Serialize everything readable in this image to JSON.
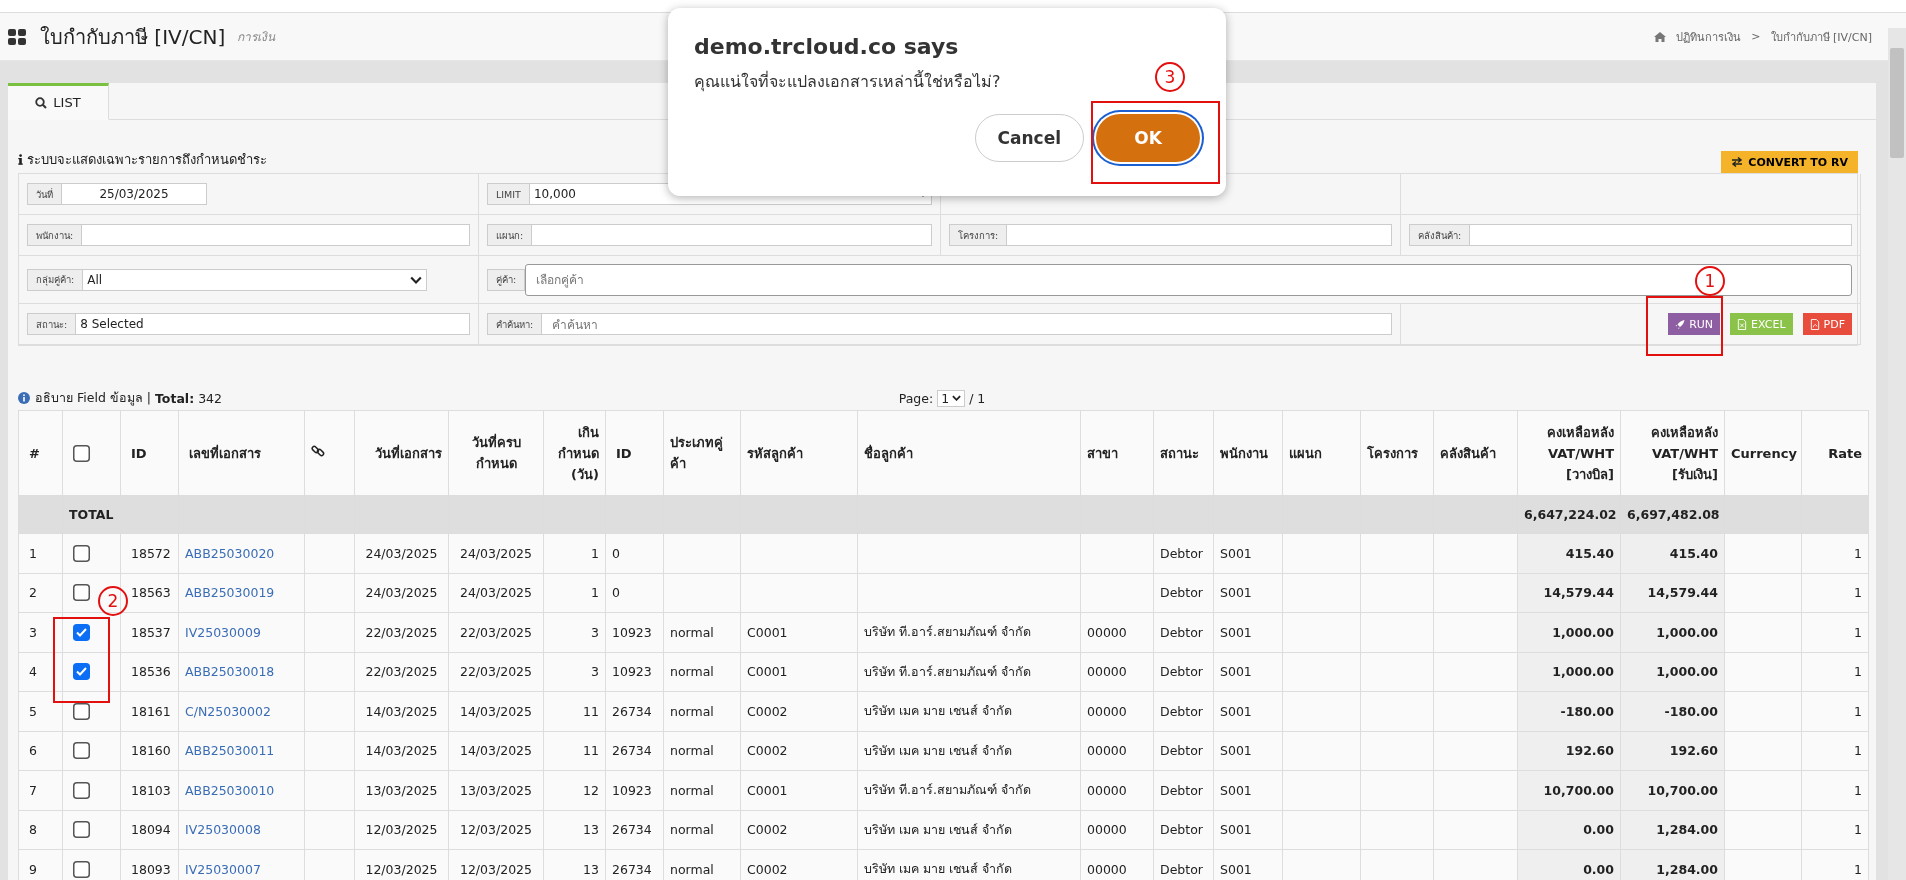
{
  "header": {
    "title": "ใบกำกับภาษี [IV/CN]",
    "subtitle": "การเงิน",
    "breadcrumb": [
      "ปฏิทินการเงิน",
      "ใบกำกับภาษี [IV/CN]"
    ],
    "separator": ">"
  },
  "tabs": [
    {
      "label": "LIST",
      "selected": true
    }
  ],
  "notice": "ระบบจะแสดงเฉพาะรายการถึงกำหนดชำระ",
  "convert_button": "CONVERT TO RV",
  "filters": {
    "date": {
      "label": "วันที่",
      "value": "25/03/2025"
    },
    "limit": {
      "label": "LIMIT",
      "value": "10,000"
    },
    "employee": {
      "label": "พนักงาน:"
    },
    "department": {
      "label": "แผนก:"
    },
    "project": {
      "label": "โครงการ:"
    },
    "warehouse": {
      "label": "คลังสินค้า:"
    },
    "customer_group": {
      "label": "กลุ่มคู่ค้า:",
      "value": "All"
    },
    "customer": {
      "label": "คู่ค้า:",
      "placeholder": "เลือกคู่ค้า"
    },
    "status": {
      "label": "สถานะ:",
      "value": "8 Selected"
    },
    "search": {
      "label": "คำค้นหา:",
      "placeholder": "คำค้นหา"
    }
  },
  "actions": [
    {
      "label": "RUN",
      "kind": "run"
    },
    {
      "label": "EXCEL",
      "kind": "excel"
    },
    {
      "label": "PDF",
      "kind": "pdf"
    }
  ],
  "table_info": "อธิบาย Field ข้อมูล | **Total:** 342",
  "pager": {
    "label": "Page:",
    "value": "1",
    "of": "/ 1"
  },
  "table": {
    "columns": [
      {
        "kind": "text",
        "label": "#"
      },
      {
        "kind": "checkbox",
        "checked": false
      },
      {
        "kind": "text",
        "label": "ID"
      },
      {
        "kind": "text",
        "label": "เลขที่เอกสาร"
      },
      {
        "kind": "link-icon"
      },
      {
        "kind": "text",
        "label": "วันที่เอกสาร"
      },
      {
        "kind": "text",
        "label": "วันที่ครบ กำหนด"
      },
      {
        "kind": "text",
        "label": "เกิน กำหนด (วัน)"
      },
      {
        "kind": "text",
        "label": "ID"
      },
      {
        "kind": "text",
        "label": "ประเภทคู่ค้า"
      },
      {
        "kind": "text",
        "label": "รหัสลูกค้า"
      },
      {
        "kind": "text",
        "label": "ชื่อลูกค้า"
      },
      {
        "kind": "text",
        "label": "สาขา"
      },
      {
        "kind": "text",
        "label": "สถานะ"
      },
      {
        "kind": "text",
        "label": "พนักงาน"
      },
      {
        "kind": "text",
        "label": "แผนก"
      },
      {
        "kind": "text",
        "label": "โครงการ"
      },
      {
        "kind": "text",
        "label": "คลังสินค้า"
      },
      {
        "kind": "text",
        "label": "คงเหลือหลัง VAT/WHT [วางบิล]"
      },
      {
        "kind": "text",
        "label": "คงเหลือหลัง VAT/WHT [รับเงิน]"
      },
      {
        "kind": "text",
        "label": "Currency"
      },
      {
        "kind": "text",
        "label": "Rate"
      }
    ],
    "total": {
      "label": "TOTAL",
      "billing": "6,647,224.02",
      "receipt": "6,697,482.08"
    },
    "rows": [
      {
        "no": "1",
        "checked": false,
        "id": "18572",
        "doc": "ABB25030020",
        "date": "24/03/2025",
        "due": "24/03/2025",
        "overdue": "1",
        "cid": "0",
        "status": "Debtor",
        "employee": "S001",
        "billing": "415.40",
        "receipt": "415.40",
        "rate": "1"
      },
      {
        "no": "2",
        "checked": false,
        "id": "18563",
        "doc": "ABB25030019",
        "date": "24/03/2025",
        "due": "24/03/2025",
        "overdue": "1",
        "cid": "0",
        "status": "Debtor",
        "employee": "S001",
        "billing": "14,579.44",
        "receipt": "14,579.44",
        "rate": "1"
      },
      {
        "no": "3",
        "checked": true,
        "id": "18537",
        "doc": "IV25030009",
        "date": "22/03/2025",
        "due": "22/03/2025",
        "overdue": "3",
        "cid": "10923",
        "type": "normal",
        "code": "C0001",
        "name": "บริษัท ที.อาร์.สยามภัณฑ์ จำกัด",
        "branch": "00000",
        "status": "Debtor",
        "employee": "S001",
        "billing": "1,000.00",
        "receipt": "1,000.00",
        "rate": "1"
      },
      {
        "no": "4",
        "checked": true,
        "id": "18536",
        "doc": "ABB25030018",
        "date": "22/03/2025",
        "due": "22/03/2025",
        "overdue": "3",
        "cid": "10923",
        "type": "normal",
        "code": "C0001",
        "name": "บริษัท ที.อาร์.สยามภัณฑ์ จำกัด",
        "branch": "00000",
        "status": "Debtor",
        "employee": "S001",
        "billing": "1,000.00",
        "receipt": "1,000.00",
        "rate": "1"
      },
      {
        "no": "5",
        "checked": false,
        "id": "18161",
        "doc": "C/N25030002",
        "date": "14/03/2025",
        "due": "14/03/2025",
        "overdue": "11",
        "cid": "26734",
        "type": "normal",
        "code": "C0002",
        "name": "บริษัท เมค มาย เชนส์ จำกัด",
        "branch": "00000",
        "status": "Debtor",
        "employee": "S001",
        "billing": "-180.00",
        "receipt": "-180.00",
        "rate": "1"
      },
      {
        "no": "6",
        "checked": false,
        "id": "18160",
        "doc": "ABB25030011",
        "date": "14/03/2025",
        "due": "14/03/2025",
        "overdue": "11",
        "cid": "26734",
        "type": "normal",
        "code": "C0002",
        "name": "บริษัท เมค มาย เชนส์ จำกัด",
        "branch": "00000",
        "status": "Debtor",
        "employee": "S001",
        "billing": "192.60",
        "receipt": "192.60",
        "rate": "1"
      },
      {
        "no": "7",
        "checked": false,
        "id": "18103",
        "doc": "ABB25030010",
        "date": "13/03/2025",
        "due": "13/03/2025",
        "overdue": "12",
        "cid": "10923",
        "type": "normal",
        "code": "C0001",
        "name": "บริษัท ที.อาร์.สยามภัณฑ์ จำกัด",
        "branch": "00000",
        "status": "Debtor",
        "employee": "S001",
        "billing": "10,700.00",
        "receipt": "10,700.00",
        "rate": "1"
      },
      {
        "no": "8",
        "checked": false,
        "id": "18094",
        "doc": "IV25030008",
        "date": "12/03/2025",
        "due": "12/03/2025",
        "overdue": "13",
        "cid": "26734",
        "type": "normal",
        "code": "C0002",
        "name": "บริษัท เมค มาย เชนส์ จำกัด",
        "branch": "00000",
        "status": "Debtor",
        "employee": "S001",
        "billing": "0.00",
        "receipt": "1,284.00",
        "rate": "1"
      },
      {
        "no": "9",
        "checked": false,
        "id": "18093",
        "doc": "IV25030007",
        "date": "12/03/2025",
        "due": "12/03/2025",
        "overdue": "13",
        "cid": "26734",
        "type": "normal",
        "code": "C0002",
        "name": "บริษัท เมค มาย เชนส์ จำกัด",
        "branch": "00000",
        "status": "Debtor",
        "employee": "S001",
        "billing": "0.00",
        "receipt": "1,284.00",
        "rate": "1"
      }
    ]
  },
  "dialog": {
    "title": "demo.trcloud.co says",
    "message": "คุณแน่ใจที่จะแปลงเอกสารเหล่านี้ใช่หรือไม่?",
    "buttons": [
      {
        "label": "Cancel",
        "kind": "cancel",
        "focused": false
      },
      {
        "label": "OK",
        "kind": "ok",
        "focused": true
      }
    ]
  },
  "annotations": [
    {
      "label": "1"
    },
    {
      "label": "2"
    },
    {
      "label": "3"
    }
  ]
}
